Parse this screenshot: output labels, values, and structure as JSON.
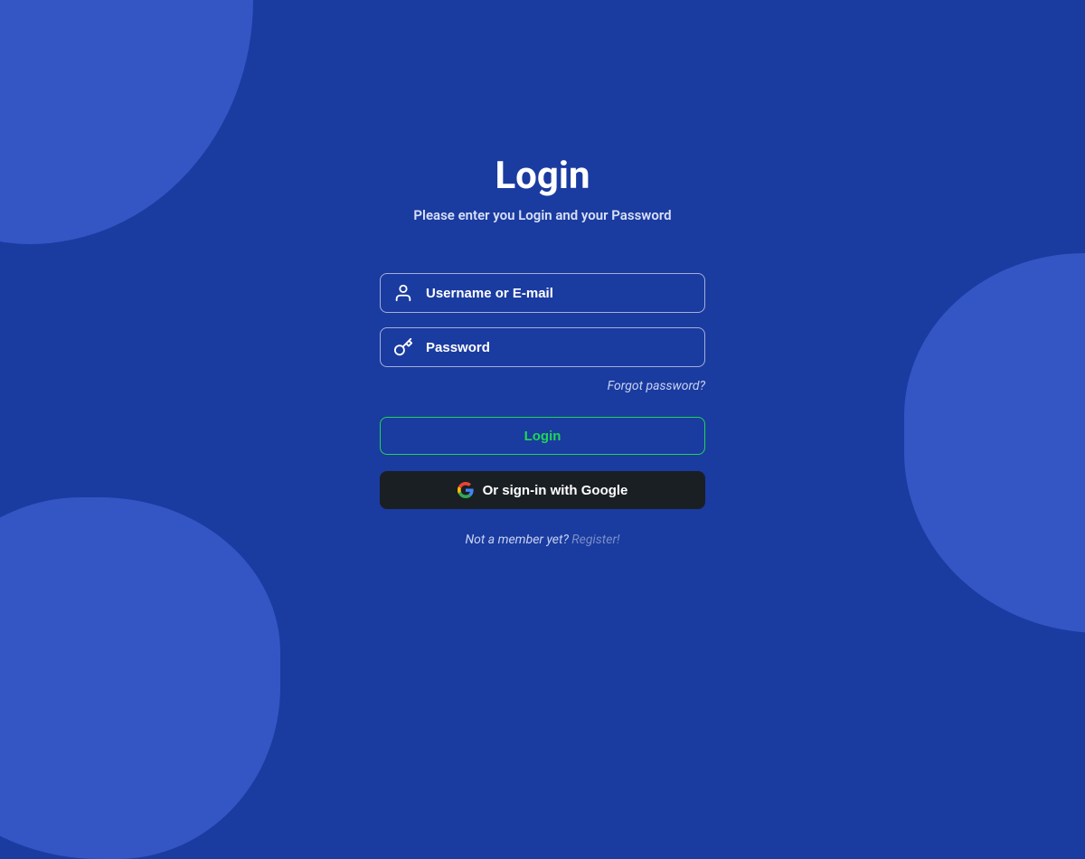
{
  "title": "Login",
  "subtitle": "Please enter you Login and your Password",
  "form": {
    "username_placeholder": "Username or E-mail",
    "password_placeholder": "Password",
    "forgot_label": "Forgot password?",
    "login_label": "Login",
    "google_label": "Or sign-in with Google"
  },
  "register": {
    "prompt": "Not a member yet? ",
    "link_label": "Register!"
  }
}
